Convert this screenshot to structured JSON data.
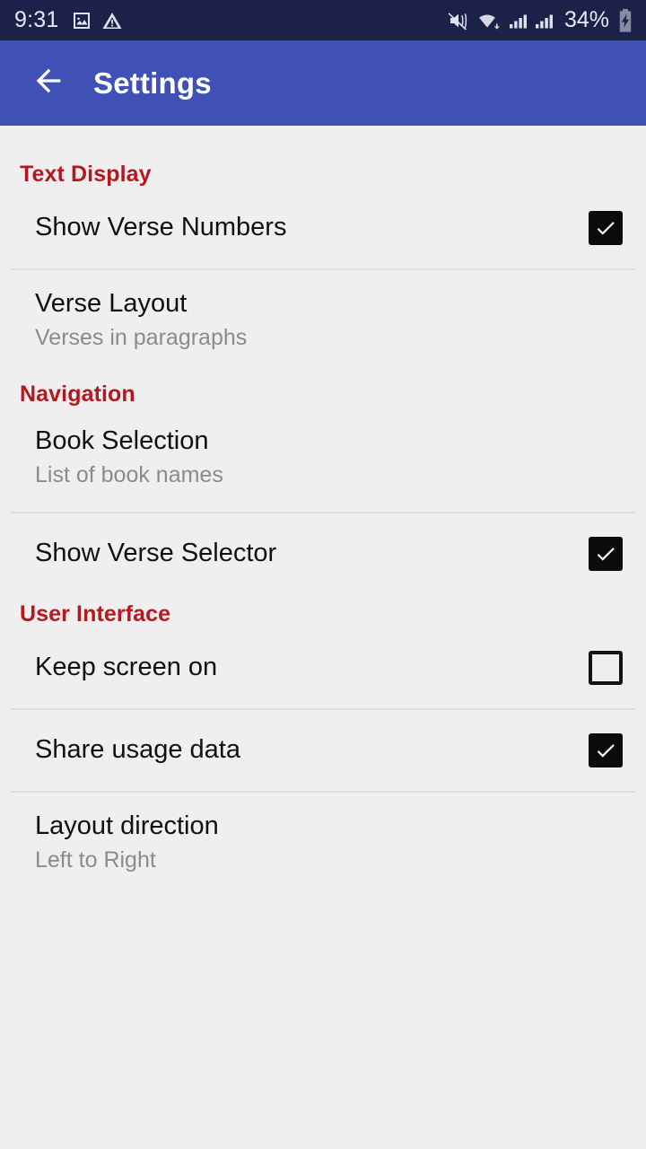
{
  "statusbar": {
    "clock": "9:31",
    "left_icons": [
      "image-icon",
      "warning-icon"
    ],
    "right_icons": [
      "volume-mute-icon",
      "wifi-icon",
      "signal-icon",
      "signal-icon"
    ],
    "battery_text": "34%",
    "battery_icon": "battery-charging-icon"
  },
  "appbar": {
    "back_icon": "arrow-back-icon",
    "title": "Settings",
    "background": "#3f51b5"
  },
  "colors": {
    "section_header": "#b3191e",
    "statusbar_bg": "#1b2149",
    "page_bg": "#efeff0",
    "title_text": "#101010",
    "summary_text": "#8b8b8b"
  },
  "sections": [
    {
      "header": "Text Display",
      "rows": [
        {
          "title": "Show Verse Numbers",
          "summary": "",
          "control": "checkbox",
          "checked": true,
          "divider_after": true
        },
        {
          "title": "Verse Layout",
          "summary": "Verses in paragraphs",
          "control": "none",
          "checked": false,
          "divider_after": false
        }
      ]
    },
    {
      "header": "Navigation",
      "rows": [
        {
          "title": "Book Selection",
          "summary": "List of book names",
          "control": "none",
          "checked": false,
          "divider_after": true
        },
        {
          "title": "Show Verse Selector",
          "summary": "",
          "control": "checkbox",
          "checked": true,
          "divider_after": false
        }
      ]
    },
    {
      "header": "User Interface",
      "rows": [
        {
          "title": "Keep screen on",
          "summary": "",
          "control": "checkbox",
          "checked": false,
          "divider_after": true
        },
        {
          "title": "Share usage data",
          "summary": "",
          "control": "checkbox",
          "checked": true,
          "divider_after": true
        },
        {
          "title": "Layout direction",
          "summary": "Left to Right",
          "control": "none",
          "checked": false,
          "divider_after": false
        }
      ]
    }
  ]
}
